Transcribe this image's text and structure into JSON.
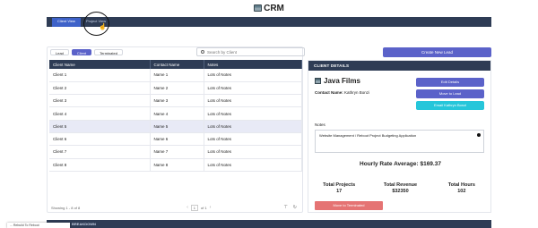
{
  "app": {
    "title": "CRM"
  },
  "nav": {
    "tabs": [
      "Client View",
      "Project View"
    ],
    "active": 0
  },
  "filters": {
    "items": [
      "Lead",
      "Client",
      "Terminated"
    ],
    "active": 1
  },
  "search": {
    "placeholder": "Search by Client",
    "value": ""
  },
  "table": {
    "columns": [
      "Client Name",
      "Contact Name",
      "Notes"
    ],
    "rows": [
      [
        "Client 1",
        "Name 1",
        "Lots of Notes"
      ],
      [
        "Client 2",
        "Name 2",
        "Lots of Notes"
      ],
      [
        "Client 3",
        "Name 3",
        "Lots of Notes"
      ],
      [
        "Client 4",
        "Name 4",
        "Lots of Notes"
      ],
      [
        "Client 5",
        "Name 5",
        "Lots of Notes"
      ],
      [
        "Client 6",
        "Name 6",
        "Lots of Notes"
      ],
      [
        "Client 7",
        "Name 7",
        "Lots of Notes"
      ],
      [
        "Client 8",
        "Name 8",
        "Lots of Notes"
      ]
    ],
    "selected_row": 4
  },
  "pager": {
    "summary": "Showing 1 - 8 of 8",
    "page": "1",
    "of_label": "of 1"
  },
  "actions": {
    "create_lead": "Create New Lead"
  },
  "details": {
    "header": "CLIENT DETAILS",
    "client_name": "Java Films",
    "contact_label": "Contact Name:",
    "contact_value": "Kathryn Bonzi",
    "edit_button": "Edit Details",
    "move_button": "Move to Lead",
    "email_button": "Email Kathryn Bonzi",
    "notes_label": "Notes",
    "notes_value": "Website Management / Reboot Project Budgeting Application",
    "hourly_rate": "Hourly Rate Average: $169.37",
    "stats": [
      {
        "label": "Total Projects",
        "value": "17"
      },
      {
        "label": "Total Revenue",
        "value": "$32350"
      },
      {
        "label": "Total Hours",
        "value": "102"
      }
    ],
    "terminate_button": "Move to Terminated"
  },
  "bottom": {
    "label": "BREAKDOWN"
  },
  "toast": {
    "text": "... Rebuild To Reboot"
  },
  "colors": {
    "navy": "#2e3c55",
    "accent": "#5b62c9",
    "cyan": "#26c6da",
    "danger": "#e57373"
  }
}
